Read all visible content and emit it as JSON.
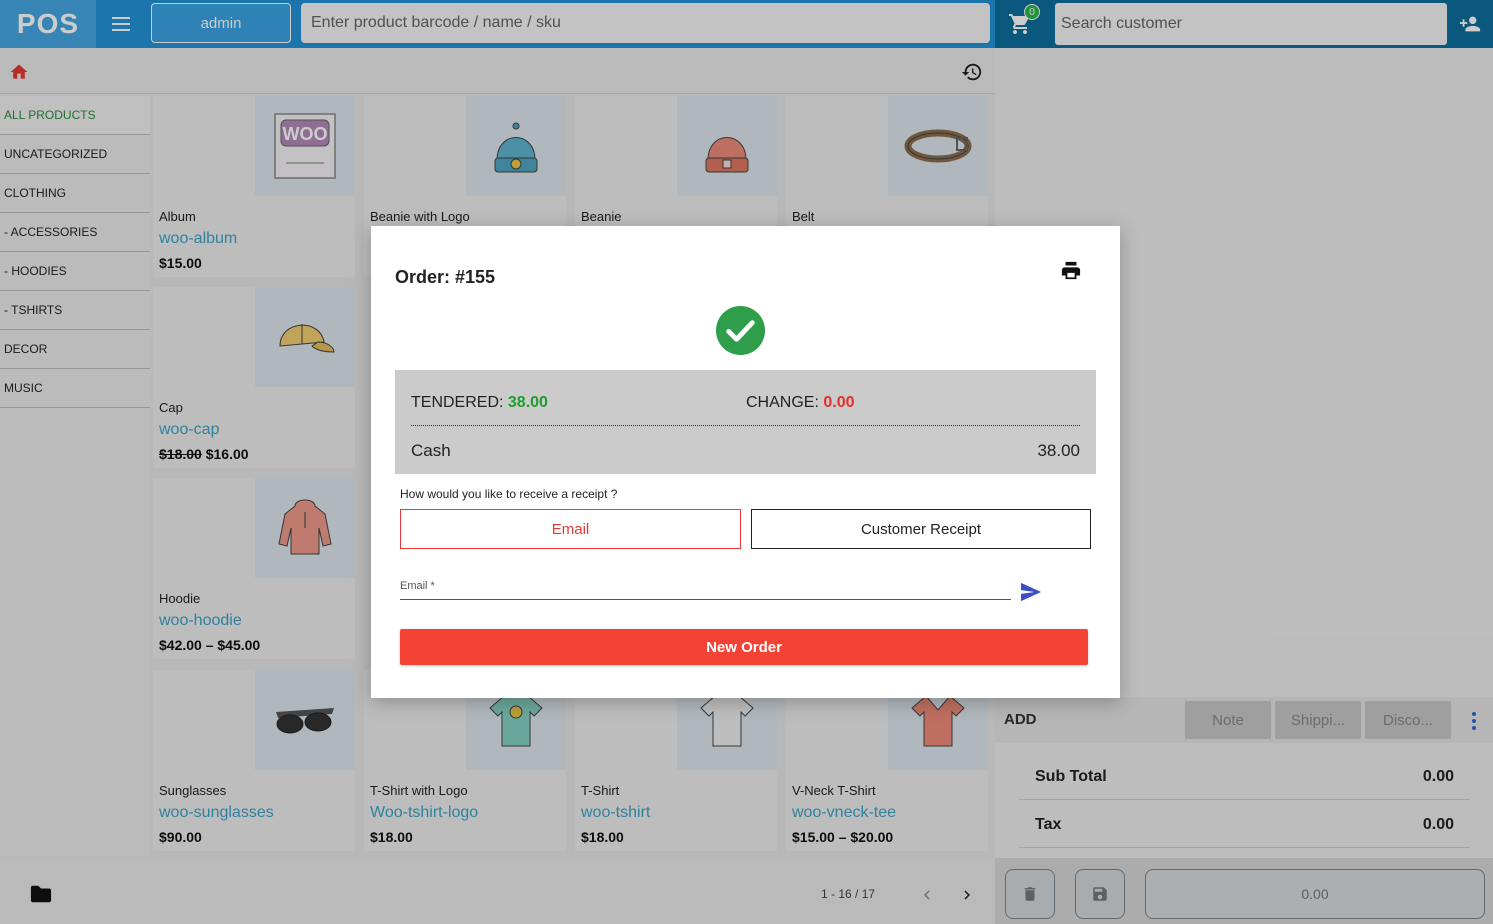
{
  "header": {
    "logo": "POS",
    "user_label": "admin",
    "product_search_placeholder": "Enter product barcode / name / sku",
    "cart_count": "0",
    "customer_search_placeholder": "Search customer"
  },
  "categories": [
    {
      "label": "ALL PRODUCTS",
      "active": true
    },
    {
      "label": "UNCATEGORIZED"
    },
    {
      "label": "CLOTHING"
    },
    {
      "label": "- ACCESSORIES"
    },
    {
      "label": "- HOODIES"
    },
    {
      "label": "- TSHIRTS"
    },
    {
      "label": "DECOR"
    },
    {
      "label": "MUSIC"
    }
  ],
  "products": [
    {
      "name": "Album",
      "sku": "woo-album",
      "price": "$15.00",
      "icon": "album-image"
    },
    {
      "name": "Beanie with Logo",
      "sku": "",
      "price": "",
      "icon": "beanie-logo-image"
    },
    {
      "name": "Beanie",
      "sku": "",
      "price": "",
      "icon": "beanie-image"
    },
    {
      "name": "Belt",
      "sku": "",
      "price": "",
      "icon": "belt-image"
    },
    {
      "name": "Cap",
      "sku": "woo-cap",
      "price_old": "$18.00",
      "price": "$16.00",
      "icon": "cap-image"
    },
    {
      "name": "Hoodie",
      "sku": "woo-hoodie",
      "price": "$42.00 – $45.00",
      "icon": "hoodie-image"
    },
    {
      "name": "Sunglasses",
      "sku": "woo-sunglasses",
      "price": "$90.00",
      "icon": "sunglasses-image"
    },
    {
      "name": "T-Shirt with Logo",
      "sku": "Woo-tshirt-logo",
      "price": "$18.00",
      "icon": "tshirt-logo-image"
    },
    {
      "name": "T-Shirt",
      "sku": "woo-tshirt",
      "price": "$18.00",
      "icon": "tshirt-image"
    },
    {
      "name": "V-Neck T-Shirt",
      "sku": "woo-vneck-tee",
      "price": "$15.00 – $20.00",
      "icon": "vneck-image"
    }
  ],
  "pagination": {
    "label": "1 - 16 / 17"
  },
  "cart_panel": {
    "add_label": "ADD",
    "note_label": "Note",
    "shipping_label": "Shippi...",
    "discount_label": "Disco...",
    "subtotal_label": "Sub Total",
    "subtotal_value": "0.00",
    "tax_label": "Tax",
    "tax_value": "0.00",
    "pay_value": "0.00"
  },
  "modal": {
    "title": "Order: #155",
    "tendered_label": "TENDERED:",
    "tendered_value": "38.00",
    "change_label": "CHANGE:",
    "change_value": "0.00",
    "method": "Cash",
    "method_amount": "38.00",
    "receipt_question": "How would you like to receive a receipt ?",
    "email_button": "Email",
    "customer_receipt_button": "Customer Receipt",
    "email_placeholder": "Email *",
    "new_order_button": "New Order"
  },
  "colors": {
    "topbar": "#2394d9",
    "topbar_right": "#0d6f9e",
    "accent_red": "#f44336",
    "success_green": "#1f9d30",
    "sku_blue": "#3aa3c5"
  }
}
